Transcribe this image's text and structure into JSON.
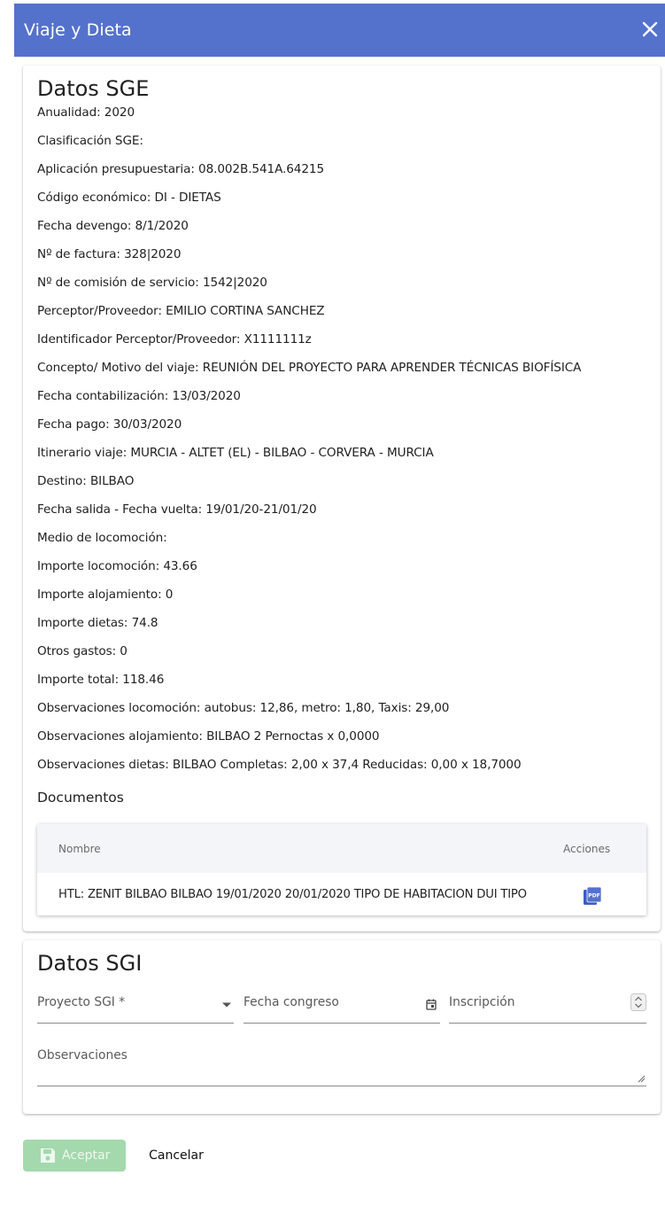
{
  "dialog": {
    "title": "Viaje y Dieta",
    "header_color": "#5472cc"
  },
  "sge": {
    "title": "Datos SGE",
    "lines": [
      "Anualidad: 2020",
      "Clasificación SGE:",
      "Aplicación presupuestaria: 08.002B.541A.64215",
      "Código económico: DI - DIETAS",
      "Fecha devengo: 8/1/2020",
      "Nº de factura: 328|2020",
      "Nº de comisión de servicio: 1542|2020",
      "Perceptor/Proveedor: EMILIO CORTINA SANCHEZ",
      "Identificador Perceptor/Proveedor: X1111111z",
      "Concepto/ Motivo del viaje: REUNIÓN DEL PROYECTO PARA APRENDER TÉCNICAS BIOFÍSICA",
      "Fecha contabilización: 13/03/2020",
      "Fecha pago: 30/03/2020",
      "Itinerario viaje: MURCIA - ALTET (EL) - BILBAO - CORVERA - MURCIA",
      "Destino: BILBAO",
      "Fecha salida - Fecha vuelta: 19/01/20-21/01/20",
      "Medio de locomoción:",
      "Importe locomoción: 43.66",
      "Importe alojamiento: 0",
      "Importe dietas: 74.8",
      "Otros gastos: 0",
      "Importe total: 118.46",
      "Observaciones locomoción: autobus: 12,86, metro: 1,80, Taxis: 29,00",
      "Observaciones alojamiento: BILBAO 2 Pernoctas x 0,0000",
      "Observaciones dietas: BILBAO Completas: 2,00 x 37,4 Reducidas: 0,00 x 18,7000"
    ],
    "documents": {
      "title": "Documentos",
      "columns": [
        "Nombre",
        "Acciones"
      ],
      "rows": [
        {
          "name": "HTL: ZENIT BILBAO BILBAO 19/01/2020 20/01/2020 TIPO DE HABITACION DUI TIPO",
          "action_icon": "pdf-icon"
        }
      ]
    }
  },
  "sgi": {
    "title": "Datos SGI",
    "fields": {
      "proyecto_label": "Proyecto SGI *",
      "fecha_label": "Fecha congreso",
      "inscripcion_label": "Inscripción",
      "observaciones_label": "Observaciones"
    }
  },
  "actions": {
    "accept_label": "Aceptar",
    "cancel_label": "Cancelar",
    "accept_color": "#a3d9ad"
  }
}
